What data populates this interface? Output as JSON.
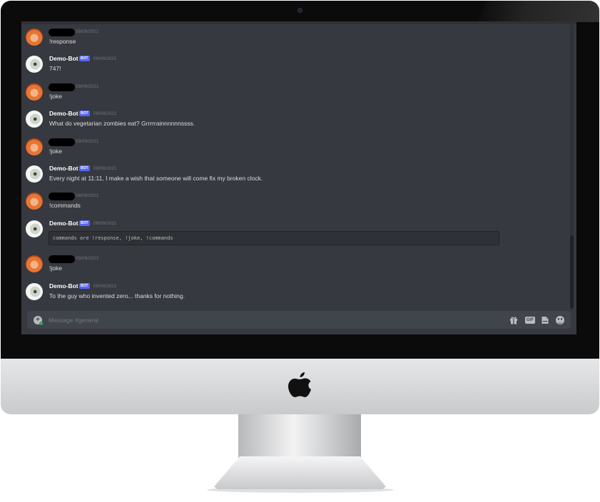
{
  "channel": {
    "input_placeholder": "Message #general"
  },
  "messages": [
    {
      "type": "user",
      "timestamp": "09/09/2021",
      "text": "!response"
    },
    {
      "type": "bot",
      "author": "Demo-Bot",
      "badge": "BOT",
      "timestamp": "09/09/2021",
      "text": "747!"
    },
    {
      "type": "user",
      "timestamp": "09/09/2021",
      "text": "!joke"
    },
    {
      "type": "bot",
      "author": "Demo-Bot",
      "badge": "BOT",
      "timestamp": "09/09/2021",
      "text": "What do vegetarian zombies eat? Grrrrrainnnnnnssss."
    },
    {
      "type": "user",
      "timestamp": "09/09/2021",
      "text": "!joke"
    },
    {
      "type": "bot",
      "author": "Demo-Bot",
      "badge": "BOT",
      "timestamp": "09/09/2021",
      "text": "Every night at 11:11, I make a wish that someone will come fix my broken clock."
    },
    {
      "type": "user",
      "timestamp": "09/09/2021",
      "text": "!commands"
    },
    {
      "type": "bot",
      "author": "Demo-Bot",
      "badge": "BOT",
      "timestamp": "09/09/2021",
      "code": "commands are !response, !joke, !commands"
    },
    {
      "type": "user",
      "timestamp": "09/09/2021",
      "text": "!joke"
    },
    {
      "type": "bot",
      "author": "Demo-Bot",
      "badge": "BOT",
      "timestamp": "09/09/2021",
      "text": "To the guy who invented zero... thanks for nothing."
    }
  ],
  "input_bar": {
    "gif_label": "GIF",
    "icons": [
      "add-attachment-icon",
      "gift-icon",
      "gif-icon",
      "sticker-icon",
      "emoji-icon"
    ]
  },
  "colors": {
    "background": "#36393f",
    "input": "#40444b",
    "bot_badge": "#5865f2",
    "text": "#dcddde",
    "timestamp": "#72767d"
  }
}
